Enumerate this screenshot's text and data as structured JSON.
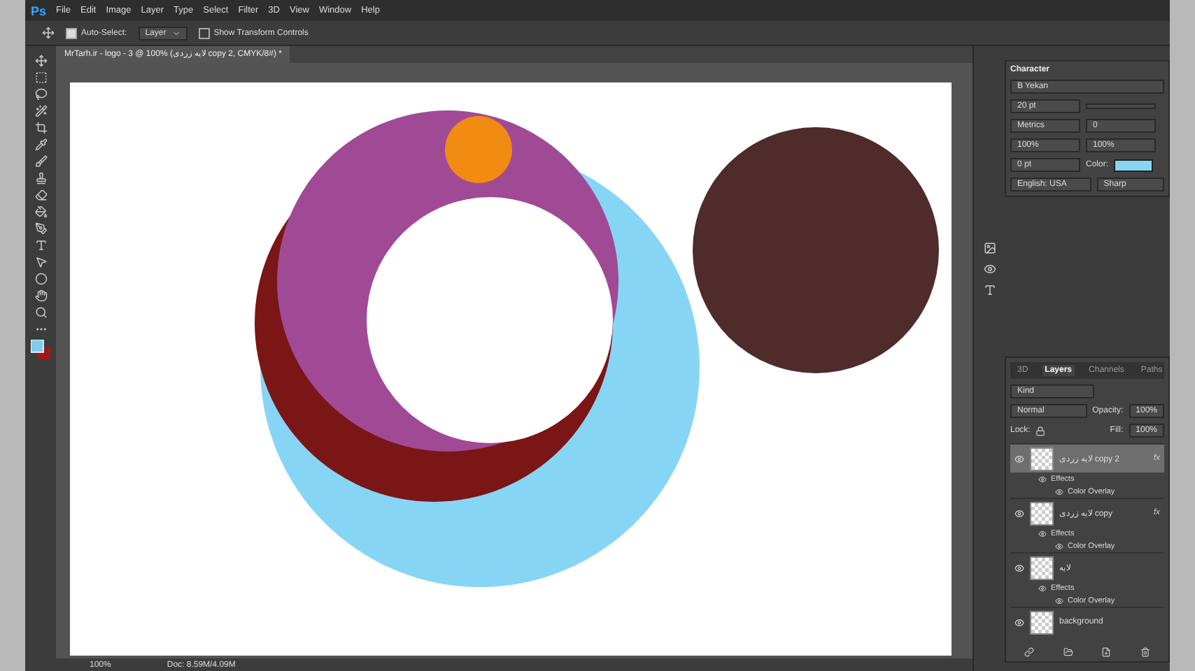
{
  "menu": {
    "logo": "Ps",
    "items": [
      "File",
      "Edit",
      "Image",
      "Layer",
      "Type",
      "Select",
      "Filter",
      "3D",
      "View",
      "Window",
      "Help"
    ]
  },
  "options_bar": {
    "auto_select": {
      "label": "Auto-Select:",
      "checked": true
    },
    "target": "Layer",
    "transform_controls": {
      "label": "Show Transform Controls",
      "checked": false
    }
  },
  "document_tab": {
    "title": "MrTarh.ir - logo - 3 @ 100% (لایه زردی copy 2, CMYK/8#) *"
  },
  "character_panel": {
    "title": "Character",
    "font": "B Yekan",
    "size": "20 pt",
    "kerning": "Metrics",
    "tracking": "0",
    "vertical_scale": "100%",
    "horizontal_scale": "100%",
    "baseline": "0 pt",
    "color_label": "Color:",
    "language": "English: USA",
    "antialias": "Sharp"
  },
  "layers_panel": {
    "tabs": [
      {
        "label": "3D",
        "selected": false
      },
      {
        "label": "Layers",
        "selected": true
      },
      {
        "label": "Channels",
        "selected": false
      },
      {
        "label": "Paths",
        "selected": false
      }
    ],
    "filter": "Kind",
    "blend": "Normal",
    "opacity_label": "Opacity:",
    "opacity": "100%",
    "lock_label": "Lock:",
    "fill_label": "Fill:",
    "fill": "100%",
    "layers": [
      {
        "name": "لایه زردی copy 2",
        "visible": true,
        "fx": "fx",
        "selected": true,
        "effects": [
          "Effects",
          "Color Overlay"
        ]
      },
      {
        "name": "لایه زردی copy",
        "visible": true,
        "fx": "fx",
        "selected": false,
        "effects": [
          "Effects",
          "Color Overlay"
        ]
      },
      {
        "name": "لایه",
        "visible": true,
        "selected": false,
        "effects": [
          "Effects",
          "Color Overlay"
        ]
      },
      {
        "name": "background",
        "visible": true,
        "selected": false
      }
    ]
  },
  "status_bar": {
    "zoom": "100%",
    "doc": "Doc: 8.59M/4.09M"
  }
}
